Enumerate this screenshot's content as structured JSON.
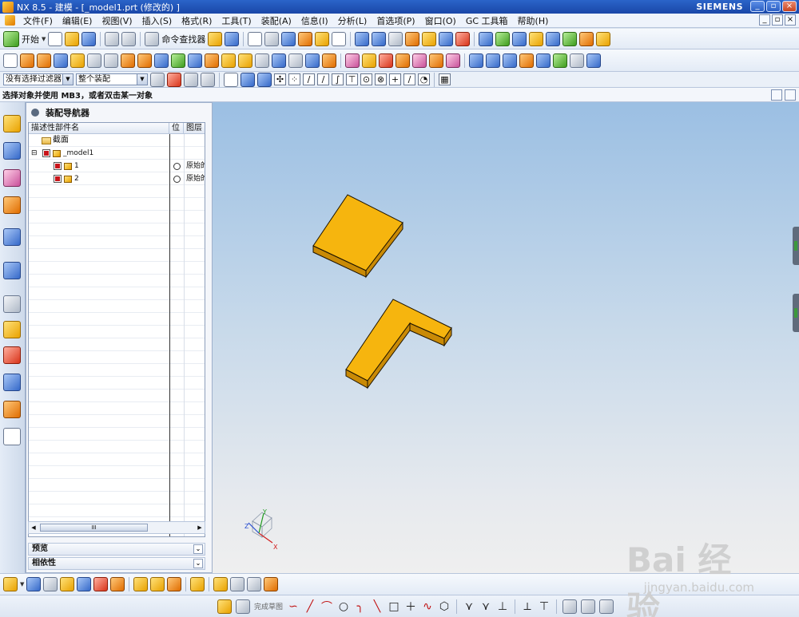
{
  "window": {
    "title": "NX 8.5 - 建模 - [_model1.prt  (修改的) ]",
    "brand": "SIEMENS",
    "controls": [
      "_",
      "▫",
      "×"
    ]
  },
  "menubar": {
    "items": [
      "文件(F)",
      "编辑(E)",
      "视图(V)",
      "插入(S)",
      "格式(R)",
      "工具(T)",
      "装配(A)",
      "信息(I)",
      "分析(L)",
      "首选项(P)",
      "窗口(O)",
      "GC 工具箱",
      "帮助(H)"
    ]
  },
  "toolbar1": {
    "start_label": "开始",
    "command_finder_label": "命令查找器"
  },
  "selection_bar": {
    "filter_value": "没有选择过滤器",
    "scope_value": "整个装配"
  },
  "cue_line": {
    "text": "选择对象并使用 MB3，或者双击某一对象"
  },
  "navigator": {
    "title": "装配导航器",
    "columns": [
      "描述性部件名",
      "位",
      "图层"
    ],
    "rows": [
      {
        "name": "截面",
        "position": "",
        "layer": ""
      },
      {
        "name": "_model1",
        "position": "",
        "layer": ""
      },
      {
        "name": "1",
        "position": "○",
        "layer": "原始的"
      },
      {
        "name": "2",
        "position": "○",
        "layer": "原始的"
      }
    ],
    "sections": [
      "预览",
      "相依性"
    ],
    "scroll_thumb": "III"
  },
  "viewport": {
    "triad": {
      "x": "X",
      "y": "Y",
      "z": "Z"
    },
    "part_color": "#f6b50e",
    "part_edge_color": "#1d1300"
  },
  "sketch_toolbar": {
    "finish_label": "完成草图"
  },
  "watermark": {
    "logo": "Bai 经验",
    "url": "jingyan.baidu.com"
  }
}
